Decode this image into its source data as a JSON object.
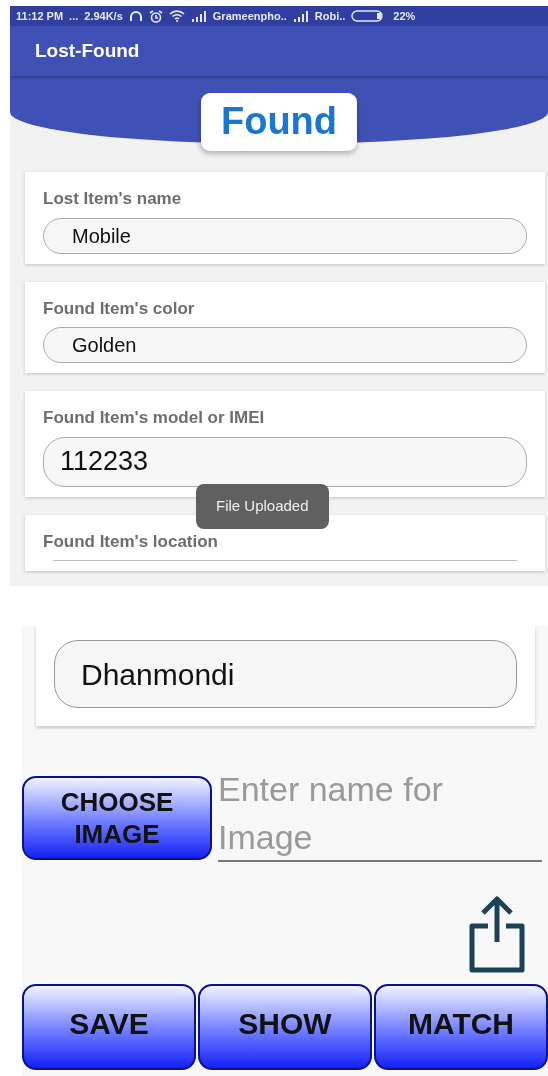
{
  "top_screen": {
    "status_bar": {
      "time": "11:12 PM",
      "dots": "...",
      "network_speed": "2.94K/s",
      "carrier_1": "Grameenpho..",
      "carrier_2": "Robi..",
      "battery": "22%"
    },
    "app_bar": {
      "title": "Lost-Found"
    },
    "heading": "Found",
    "fields": [
      {
        "label": "Lost Item's name",
        "value": "Mobile"
      },
      {
        "label": "Found Item's color",
        "value": "Golden"
      },
      {
        "label": "Found Item's model or IMEI",
        "value": "112233"
      },
      {
        "label": "Found Item's location"
      }
    ],
    "toast": "File Uploaded"
  },
  "bottom_screen": {
    "location_value": "Dhanmondi",
    "choose_image_button": "CHOOSE IMAGE",
    "image_name_field": {
      "placeholder": "Enter name for Image"
    },
    "buttons": [
      "SAVE",
      "SHOW",
      "MATCH"
    ]
  }
}
